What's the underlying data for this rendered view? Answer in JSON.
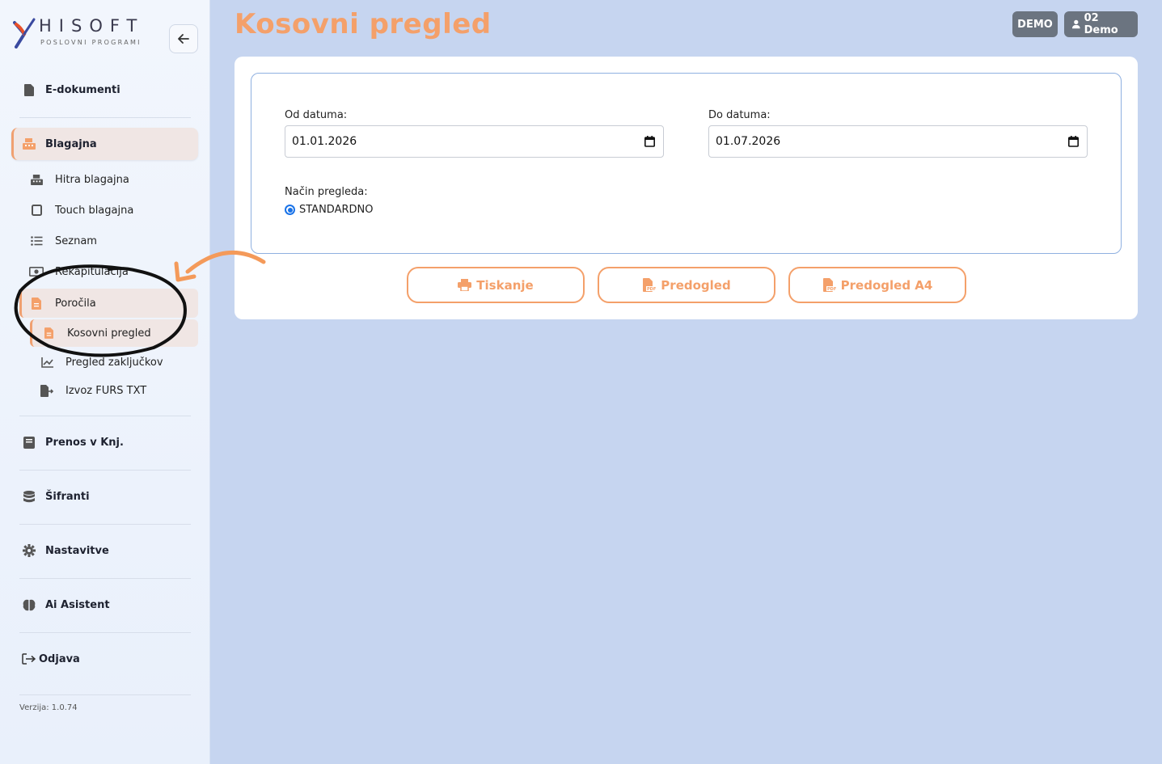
{
  "brand": {
    "name": "HISOFT",
    "tagline": "POSLOVNI PROGRAMI"
  },
  "sidebar": {
    "items": [
      {
        "label": "E-dokumenti",
        "icon": "file-icon"
      },
      {
        "label": "Blagajna",
        "icon": "cash-register-icon",
        "active": true
      },
      {
        "label": "Prenos v Knj.",
        "icon": "book-icon"
      },
      {
        "label": "Šifranti",
        "icon": "database-icon"
      },
      {
        "label": "Nastavitve",
        "icon": "gear-icon"
      },
      {
        "label": "Ai Asistent",
        "icon": "brain-icon"
      },
      {
        "label": "Odjava",
        "icon": "logout-icon"
      }
    ],
    "blagajna_sub": [
      {
        "label": "Hitra blagajna",
        "icon": "cash-register-icon"
      },
      {
        "label": "Touch blagajna",
        "icon": "tablet-icon"
      },
      {
        "label": "Seznam",
        "icon": "list-icon"
      },
      {
        "label": "Rekapitulacija",
        "icon": "money-icon"
      },
      {
        "label": "Poročila",
        "icon": "report-icon",
        "active": true
      }
    ],
    "porocila_sub": [
      {
        "label": "Kosovni pregled",
        "icon": "report-icon",
        "active": true
      },
      {
        "label": "Pregled zaključkov",
        "icon": "chart-line-icon"
      },
      {
        "label": "Izvoz FURS TXT",
        "icon": "file-export-icon"
      }
    ],
    "version": "Verzija: 1.0.74"
  },
  "header": {
    "title": "Kosovni pregled",
    "badge_demo": "DEMO",
    "badge_user": "02 Demo"
  },
  "form": {
    "from_label": "Od datuma:",
    "from_value": "01.01.2026",
    "to_label": "Do datuma:",
    "to_value": "01.07.2026",
    "mode_label": "Način pregleda:",
    "mode_option": "STANDARDNO"
  },
  "actions": {
    "print": "Tiskanje",
    "preview": "Predogled",
    "preview_a4": "Predogled A4"
  },
  "colors": {
    "accent": "#f4a06a",
    "background": "#c6d5f0",
    "badge": "#6b7480"
  }
}
